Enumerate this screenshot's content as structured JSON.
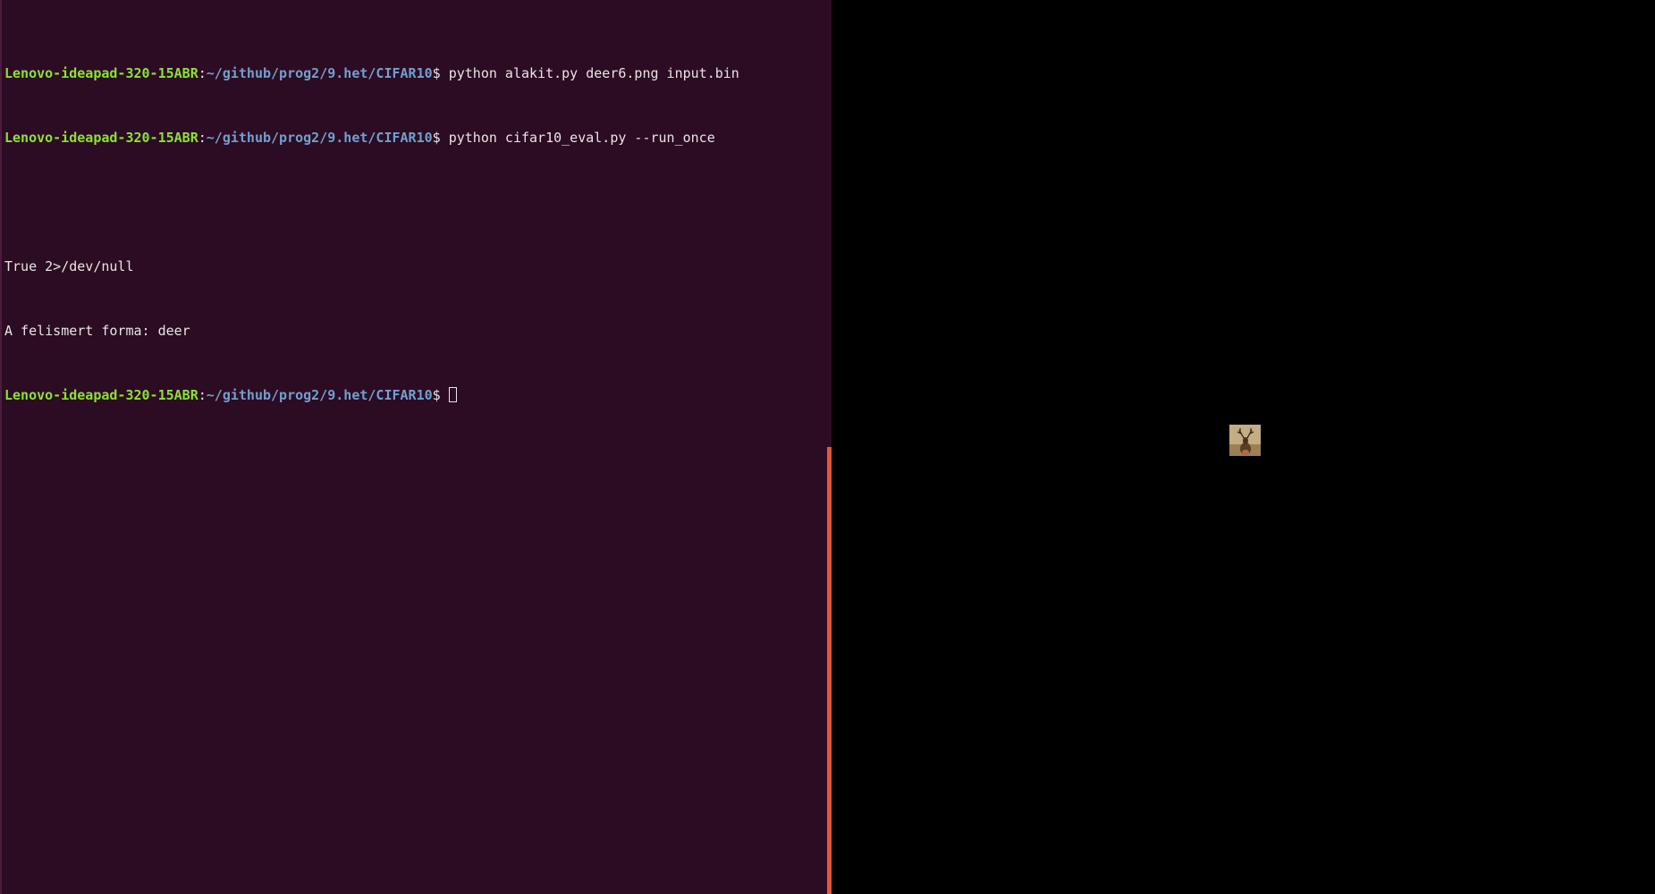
{
  "terminal": {
    "lines": [
      {
        "host": "Lenovo-ideapad-320-15ABR",
        "sep": ":",
        "path": "~/github/prog2/9.het/CIFAR10",
        "prompt": "$ ",
        "command": "python alakit.py deer6.png input.bin"
      },
      {
        "host": "Lenovo-ideapad-320-15ABR",
        "sep": ":",
        "path": "~/github/prog2/9.het/CIFAR10",
        "prompt": "$ ",
        "command": "python cifar10_eval.py --run_once"
      },
      {
        "output": ""
      },
      {
        "output": "True 2>/dev/null"
      },
      {
        "output": "A felismert forma: deer"
      },
      {
        "host": "Lenovo-ideapad-320-15ABR",
        "sep": ":",
        "path": "~/github/prog2/9.het/CIFAR10",
        "prompt": "$ "
      }
    ]
  },
  "colors": {
    "terminal_bg": "#2c0c22",
    "host": "#8ae234",
    "path": "#729fcf",
    "text": "#e8e4e6",
    "scrollbar": "#e0583a",
    "viewer_bg": "#000000"
  },
  "viewer": {
    "image_icon": "deer-photo-thumbnail"
  }
}
